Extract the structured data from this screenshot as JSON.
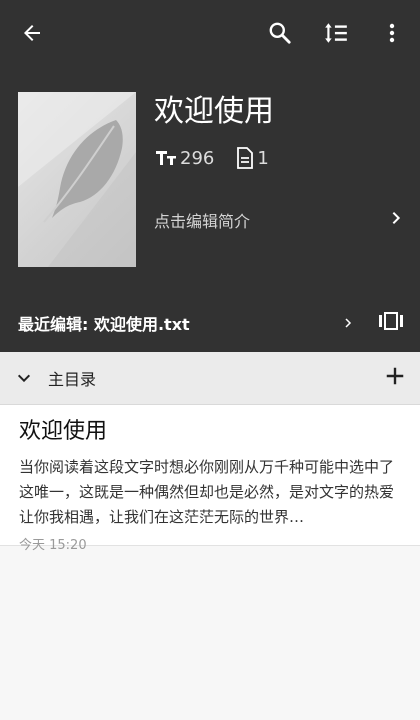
{
  "toolbar": {
    "back_icon": "arrow-back-icon",
    "search_icon": "search-icon",
    "sort_icon": "sort-icon",
    "more_icon": "more-vertical-icon"
  },
  "book": {
    "title": "欢迎使用",
    "word_count": "296",
    "chapter_count": "1",
    "intro_prompt": "点击编辑简介",
    "cover_icon": "feather-icon"
  },
  "recent": {
    "label": "最近编辑: 欢迎使用.txt"
  },
  "catalog": {
    "section_title": "主目录",
    "chapters": [
      {
        "title": "欢迎使用",
        "excerpt": "当你阅读着这段文字时想必你刚刚从万千种可能中选中了这唯一，这既是一种偶然但却也是必然，是对文字的热爱让你我相遇，让我们在这茫茫无际的世界…",
        "time": "今天 15:20"
      }
    ]
  },
  "colors": {
    "header_bg": "#323232",
    "section_bg": "#ebebeb",
    "list_bg": "#ffffff",
    "page_bg": "#f7f7f7"
  }
}
